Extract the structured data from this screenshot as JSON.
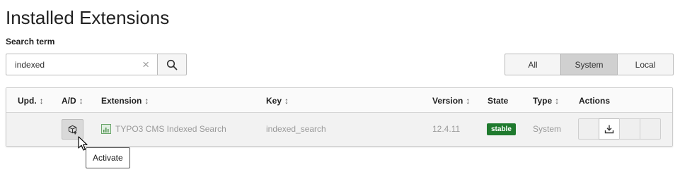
{
  "page": {
    "title": "Installed Extensions"
  },
  "search": {
    "label": "Search term",
    "value": "indexed",
    "clear_glyph": "×"
  },
  "filters": {
    "options": [
      "All",
      "System",
      "Local"
    ],
    "selected": "System"
  },
  "table": {
    "columns": {
      "upd": "Upd.",
      "ad": "A/D",
      "extension": "Extension",
      "key": "Key",
      "version": "Version",
      "state": "State",
      "type": "Type",
      "actions": "Actions"
    },
    "sort_glyph": "↕",
    "rows": [
      {
        "extension": "TYPO3 CMS Indexed Search",
        "key": "indexed_search",
        "version": "12.4.11",
        "state": "stable",
        "type": "System"
      }
    ]
  },
  "tooltip": {
    "text": "Activate"
  },
  "icons": {
    "search": "search-icon",
    "activate": "box-plus-icon",
    "extension": "chart-icon",
    "download": "download-icon",
    "cursor": "mouse-pointer"
  },
  "colors": {
    "badge_stable": "#1f7a2e",
    "active_filter": "#d0d0d0"
  }
}
